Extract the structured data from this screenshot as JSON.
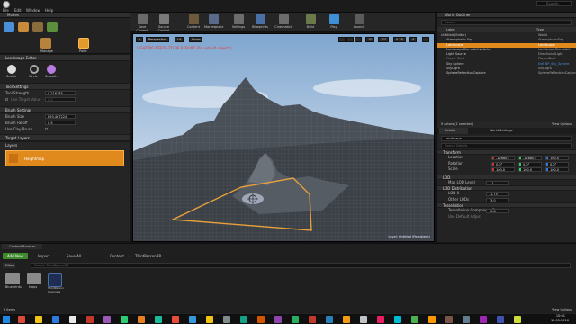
{
  "menu": {
    "items": [
      "File",
      "Edit",
      "Window",
      "Help"
    ],
    "search_placeholder": "Search"
  },
  "modes": {
    "header": "Modes",
    "mode_tabs": [
      {
        "label": ""
      },
      {
        "label": ""
      },
      {
        "label": ""
      },
      {
        "label": "Manage"
      },
      {
        "label": "Paint"
      }
    ],
    "landscape_editor": "Landscape Editor",
    "tools": [
      {
        "label": "Sculpt"
      },
      {
        "label": "Circle"
      },
      {
        "label": "Smooth"
      }
    ],
    "tool_settings": "Tool Settings",
    "tool_strength_label": "Tool Strength",
    "tool_strength_value": "0.216185",
    "use_target_value_label": "Use Target Value",
    "use_target_value": "0.0",
    "brush_settings": "Brush Settings",
    "brush_size_label": "Brush Size",
    "brush_size_value": "893.467224",
    "brush_falloff_label": "Brush Falloff",
    "brush_falloff_value": "0.5",
    "clay_brush_label": "Use Clay Brush",
    "target_layers": "Target Layers",
    "layers_label": "Layers",
    "heightmap_label": "Heightmap"
  },
  "toolbar": {
    "buttons": [
      {
        "label": "Save Current",
        "color": "#6a6a6a"
      },
      {
        "label": "Source Control",
        "color": "#7a7a7a"
      },
      {
        "label": "Content",
        "color": "#6d5a3c"
      },
      {
        "label": "Marketplace",
        "color": "#5a6a8a"
      },
      {
        "label": "Settings",
        "color": "#6c6c6c"
      },
      {
        "label": "Blueprints",
        "color": "#4a6fa5"
      },
      {
        "label": "Cinematics",
        "color": "#6c6c6c"
      },
      {
        "label": "Build",
        "color": "#6a7a4a"
      },
      {
        "label": "Play",
        "color": "#3f8fd6"
      },
      {
        "label": "Launch",
        "color": "#5b5b5b"
      }
    ]
  },
  "viewport": {
    "perspective_label": "Perspective",
    "lit_label": "Lit",
    "show_label": "Show",
    "warning": "LIGHTING NEEDS TO BE REBUILT (64 unbuilt objects)",
    "grid_value": "10",
    "angle_value": "10°",
    "scale_value": "0.25",
    "camera_speed": "4",
    "level_label": "Level: Untitled (Persistent)"
  },
  "outliner": {
    "header": "World Outliner",
    "search_placeholder": "Search...",
    "col_label": "Label",
    "col_type": "Type",
    "rows": [
      {
        "label": "Untitled (Editor)",
        "type": "World"
      },
      {
        "label": "Atmospheric Fog",
        "type": "AtmosphericFog"
      },
      {
        "label": "Landscape",
        "type": "Landscape"
      },
      {
        "label": "LandscapeGizmoActiveActor",
        "type": "LandscapeGizmoAct"
      },
      {
        "label": "Light Source",
        "type": "DirectionalLight"
      },
      {
        "label": "Player Start",
        "type": "PlayerStart"
      },
      {
        "label": "Sky Sphere",
        "type": "Edit BP_Sky_Sphere"
      },
      {
        "label": "SkyLight",
        "type": "SkyLight"
      },
      {
        "label": "SphereReflectionCapture",
        "type": "SphereReflectionCapture"
      }
    ],
    "actor_count": "9 actors (1 selected)",
    "view_options": "View Options"
  },
  "details": {
    "tab_details": "Details",
    "tab_world_settings": "World Settings",
    "actor_name": "Landscape",
    "search_placeholder": "Search Details",
    "transform": "Transform",
    "location_label": "Location",
    "location": [
      "-126803",
      "-126803",
      "100.0"
    ],
    "rotation_label": "Rotation",
    "rotation": [
      "0.0°",
      "0.0°",
      "0.0°"
    ],
    "scale_label": "Scale",
    "scale": [
      "100.0",
      "100.0",
      "100.0"
    ],
    "lod_section": "LOD",
    "max_lod_label": "Max LOD Level",
    "max_lod_value": "-1",
    "lod_distribution": "LOD Distribution",
    "lod0_label": "LOD 0",
    "lod0_value": "1.75",
    "other_lods_label": "Other LODs",
    "other_lods_value": "3.0",
    "tessellation": "Tessellation",
    "tess_label": "Tessellation Component Sc",
    "tess_value": "0.8",
    "use_default_label": "Use Default Adjust"
  },
  "content_browser": {
    "tab": "Content Browser",
    "add_new": "Add New",
    "import": "Import",
    "save_all": "Save All",
    "path": [
      "Content",
      "ThirdPersonBP"
    ],
    "filters": "Filters",
    "search_placeholder": "Search ThirdPersonBP",
    "items": [
      {
        "label": "Blueprints",
        "kind": "folder"
      },
      {
        "label": "Maps",
        "kind": "folder"
      },
      {
        "label": "ThirdPerson Overview",
        "kind": "asset"
      }
    ],
    "count": "3 items",
    "view_options": "View Options"
  },
  "taskbar": {
    "time": "10:01",
    "date": "19.05.2016",
    "icon_colors": [
      "#d94a38",
      "#f0c419",
      "#2d7be0",
      "#e8e8e8",
      "#c0392b",
      "#9b59b6",
      "#2ecc71",
      "#e67e22",
      "#1abc9c",
      "#e74c3c",
      "#3498db",
      "#f1c40f",
      "#7f8c8d",
      "#16a085",
      "#d35400",
      "#8e44ad",
      "#27ae60",
      "#c0392b",
      "#2980b9",
      "#f39c12",
      "#bdc3c7",
      "#e91e63",
      "#00bcd4",
      "#4caf50",
      "#ff9800",
      "#795548",
      "#607d8b",
      "#9c27b0",
      "#3f51b5",
      "#cddc39"
    ]
  }
}
